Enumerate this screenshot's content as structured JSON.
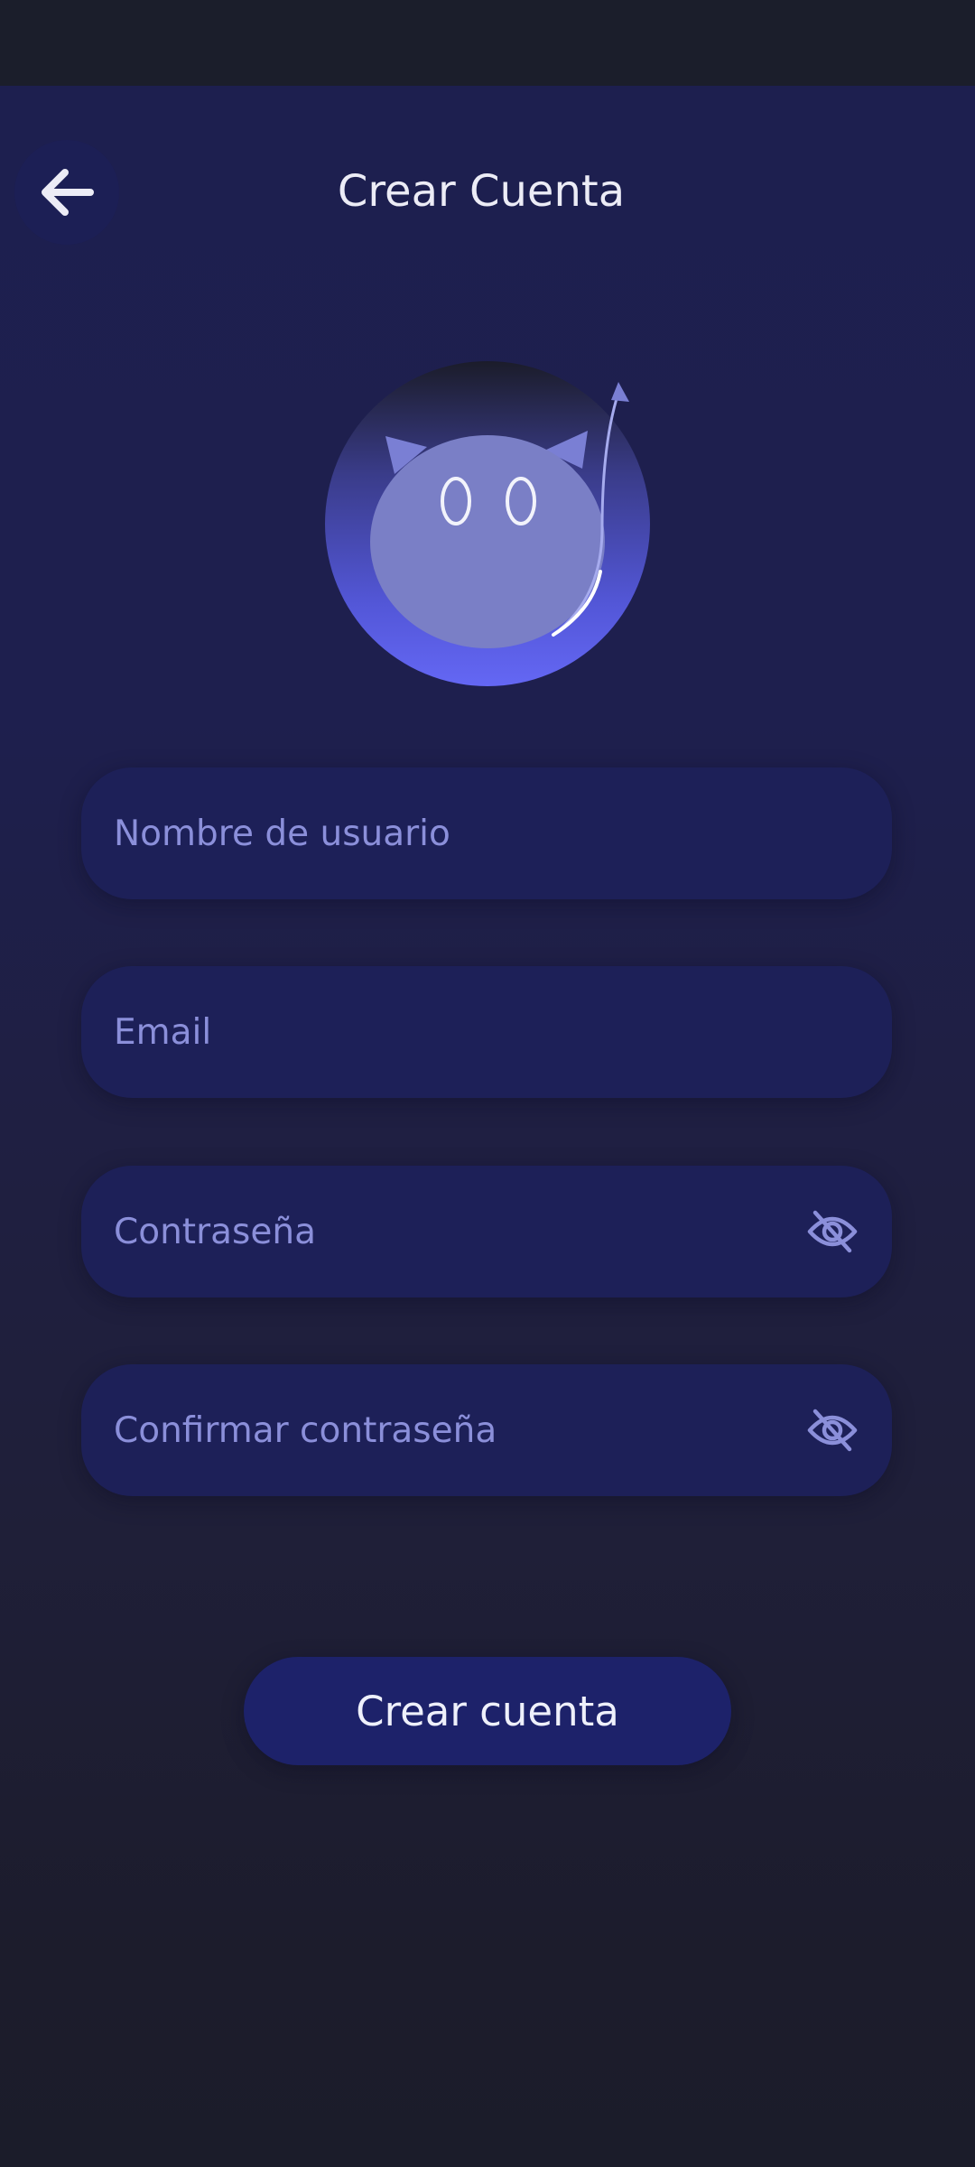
{
  "header": {
    "title": "Crear Cuenta",
    "back_icon": "arrow-left-icon"
  },
  "avatar": {
    "icon": "devil-cat-mascot-icon"
  },
  "form": {
    "username": {
      "placeholder": "Nombre de usuario",
      "value": ""
    },
    "email": {
      "placeholder": "Email",
      "value": ""
    },
    "password": {
      "placeholder": "Contraseña",
      "value": "",
      "toggle_icon": "eye-off-icon"
    },
    "confirm_password": {
      "placeholder": "Confirmar contraseña",
      "value": "",
      "toggle_icon": "eye-off-icon"
    }
  },
  "submit": {
    "label": "Crear cuenta"
  },
  "colors": {
    "background_top": "#1d1f4f",
    "background_bottom": "#1b1c2a",
    "field_bg": "#1d2058",
    "placeholder": "#8b8fda",
    "accent": "#6366f1",
    "button_bg": "#1d226a",
    "text": "#ececf6"
  }
}
